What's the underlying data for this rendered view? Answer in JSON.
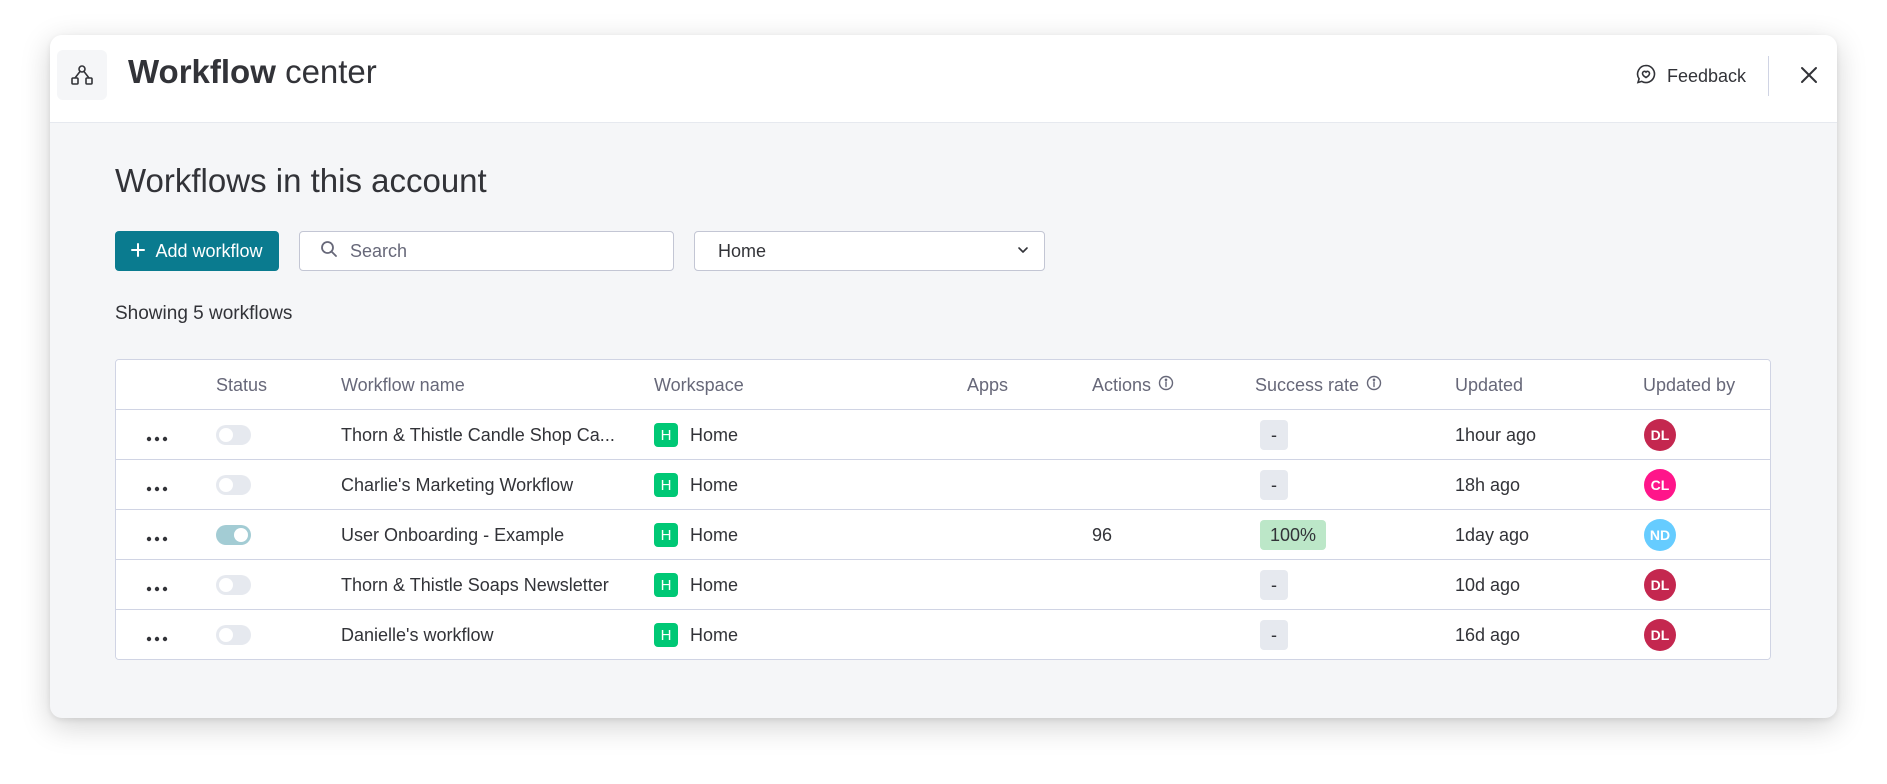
{
  "header": {
    "title_bold": "Workflow",
    "title_light": "center",
    "feedback_label": "Feedback"
  },
  "main": {
    "page_title": "Workflows in this account",
    "add_button_label": "Add workflow",
    "search_placeholder": "Search",
    "workspace_select_value": "Home",
    "showing_text": "Showing 5 workflows"
  },
  "table": {
    "columns": {
      "status": "Status",
      "workflow_name": "Workflow name",
      "workspace": "Workspace",
      "apps": "Apps",
      "actions": "Actions",
      "success_rate": "Success rate",
      "updated": "Updated",
      "updated_by": "Updated by"
    },
    "rows": [
      {
        "enabled": false,
        "name": "Thorn & Thistle Candle Shop Ca...",
        "workspace_initial": "H",
        "workspace": "Home",
        "apps": "",
        "actions": "",
        "success_rate": "-",
        "updated": "1hour ago",
        "updated_by": "DL",
        "avatar_color": "#c4274f"
      },
      {
        "enabled": false,
        "name": "Charlie's Marketing Workflow",
        "workspace_initial": "H",
        "workspace": "Home",
        "apps": "",
        "actions": "",
        "success_rate": "-",
        "updated": "18h ago",
        "updated_by": "CL",
        "avatar_color": "#ff158a"
      },
      {
        "enabled": true,
        "name": "User Onboarding - Example",
        "workspace_initial": "H",
        "workspace": "Home",
        "apps": "",
        "actions": "96",
        "success_rate": "100%",
        "updated": "1day ago",
        "updated_by": "ND",
        "avatar_color": "#66ccff"
      },
      {
        "enabled": false,
        "name": "Thorn & Thistle Soaps Newsletter",
        "workspace_initial": "H",
        "workspace": "Home",
        "apps": "",
        "actions": "",
        "success_rate": "-",
        "updated": "10d ago",
        "updated_by": "DL",
        "avatar_color": "#c4274f"
      },
      {
        "enabled": false,
        "name": "Danielle's workflow",
        "workspace_initial": "H",
        "workspace": "Home",
        "apps": "",
        "actions": "",
        "success_rate": "-",
        "updated": "16d ago",
        "updated_by": "DL",
        "avatar_color": "#c4274f"
      }
    ]
  },
  "icons": {
    "header": "workflow-icon",
    "feedback": "feedback-chat-icon",
    "close": "close-icon",
    "add": "plus-icon",
    "search": "search-icon",
    "select": "chevron-down-icon",
    "info": "info-icon",
    "row_menu": "more-horizontal-icon"
  },
  "colors": {
    "primary": "#0a7b8f",
    "workspace_badge": "#00c875",
    "success_badge": "#bce7c8"
  }
}
